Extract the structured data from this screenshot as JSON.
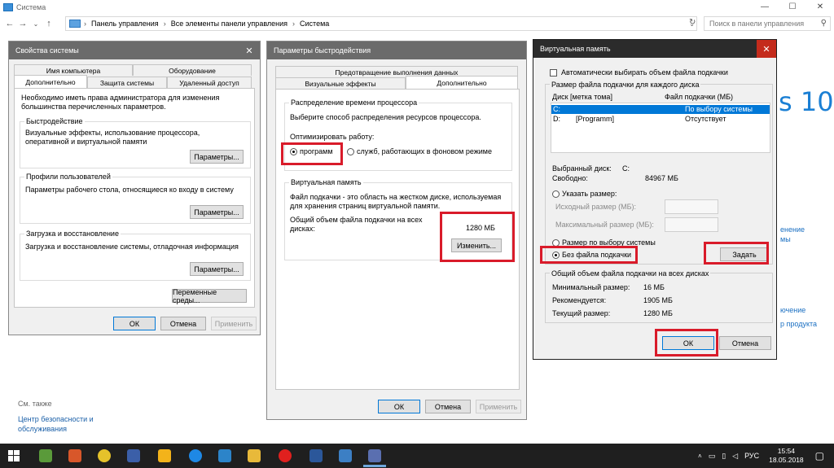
{
  "window": {
    "title": "Система",
    "controls": {
      "minimize": "—",
      "maximize": "☐",
      "close": "✕"
    },
    "nav": {
      "back": "←",
      "forward": "→",
      "down": "⌄",
      "up": "↑",
      "refresh": "↻"
    },
    "breadcrumb": [
      "Панель управления",
      "Все элементы панели управления",
      "Система"
    ],
    "breadcrumb_sep": "›",
    "search_placeholder": "Поиск в панели управления",
    "brand_text": "s 10",
    "right_links": [
      "енение",
      "мы",
      "ючение",
      "р продукта"
    ],
    "see_also": "См. также",
    "security_link": "Центр безопасности и обслуживания"
  },
  "sys_props": {
    "title": "Свойства системы",
    "tabs_row1": [
      "Имя компьютера",
      "Оборудование"
    ],
    "tabs_row2": [
      "Дополнительно",
      "Защита системы",
      "Удаленный доступ"
    ],
    "intro": "Необходимо иметь права администратора для изменения большинства перечисленных параметров.",
    "perf_label": "Быстродействие",
    "perf_desc": "Визуальные эффекты, использование процессора, оперативной и виртуальной памяти",
    "perf_btn": "Параметры...",
    "profiles_label": "Профили пользователей",
    "profiles_desc": "Параметры рабочего стола, относящиеся ко входу в систему",
    "profiles_btn": "Параметры...",
    "boot_label": "Загрузка и восстановление",
    "boot_desc": "Загрузка и восстановление системы, отладочная информация",
    "boot_btn": "Параметры...",
    "env_btn": "Переменные среды...",
    "ok": "ОК",
    "cancel": "Отмена",
    "apply": "Применить"
  },
  "perf_opts": {
    "title": "Параметры быстродействия",
    "tabs_row1": [
      "Предотвращение выполнения данных"
    ],
    "tabs_row2": [
      "Визуальные эффекты",
      "Дополнительно"
    ],
    "cpu_group": "Распределение времени процессора",
    "cpu_desc": "Выберите способ распределения ресурсов процессора.",
    "optimize_label": "Оптимизировать работу:",
    "radio_programs": "программ",
    "radio_services": "служб, работающих в фоновом режиме",
    "vm_group": "Виртуальная память",
    "vm_desc": "Файл подкачки - это область на жестком диске, используемая для хранения страниц виртуальной памяти.",
    "vm_total_label": "Общий объем файла подкачки на всех дисках:",
    "vm_total_value": "1280 МБ",
    "change_btn": "Изменить...",
    "ok": "ОК",
    "cancel": "Отмена",
    "apply": "Применить"
  },
  "virt_mem": {
    "title": "Виртуальная память",
    "close": "✕",
    "auto_label": "Автоматически выбирать объем файла подкачки",
    "size_group": "Размер файла подкачки для каждого диска",
    "col_drive": "Диск [метка тома]",
    "col_file": "Файл подкачки (МБ)",
    "drives": [
      {
        "drive": "C:",
        "label": "",
        "size": "По выбору системы"
      },
      {
        "drive": "D:",
        "label": "[Programm]",
        "size": "Отсутствует"
      }
    ],
    "selected_label": "Выбранный диск:",
    "selected_value": "C:",
    "free_label": "Свободно:",
    "free_value": "84967 МБ",
    "radio_custom": "Указать размер:",
    "initial_label": "Исходный размер (МБ):",
    "max_label": "Максимальный размер (МБ):",
    "radio_system": "Размер по выбору системы",
    "radio_none": "Без файла подкачки",
    "set_btn": "Задать",
    "total_group": "Общий объем файла подкачки на всех дисках",
    "min_label": "Минимальный размер:",
    "min_value": "16 МБ",
    "rec_label": "Рекомендуется:",
    "rec_value": "1905 МБ",
    "cur_label": "Текущий размер:",
    "cur_value": "1280 МБ",
    "ok": "ОК",
    "cancel": "Отмена"
  },
  "taskbar": {
    "start_icon": "windows-logo-icon",
    "lang": "РУС",
    "time": "15:54",
    "date": "18.05.2018"
  },
  "colors": {
    "highlight": "#d91b2a",
    "selection": "#0078d7",
    "dialog_title_active": "#2b2b2b",
    "dialog_title_inactive": "#6b6b6b"
  }
}
